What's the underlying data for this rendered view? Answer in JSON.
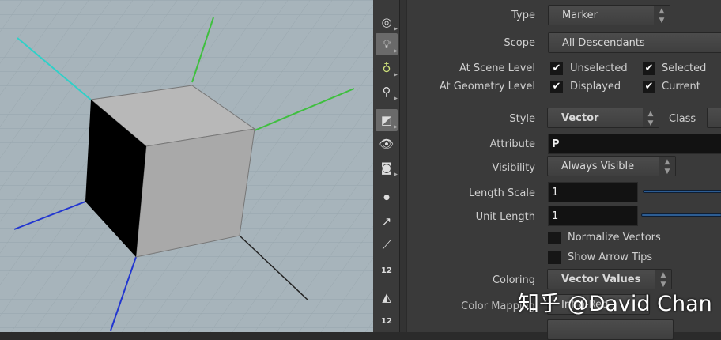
{
  "panel": {
    "type": {
      "label": "Type",
      "value": "Marker"
    },
    "scope": {
      "label": "Scope",
      "value": "All Descendants"
    },
    "scene_level": {
      "label": "At Scene Level",
      "unselected": "Unselected",
      "selected": "Selected",
      "unselected_checked": true,
      "selected_checked": true
    },
    "geometry_level": {
      "label": "At Geometry Level",
      "displayed": "Displayed",
      "current": "Current",
      "displayed_checked": true,
      "current_checked": true
    },
    "style": {
      "label": "Style",
      "value": "Vector"
    },
    "class": {
      "label": "Class"
    },
    "attribute": {
      "label": "Attribute",
      "value": "P"
    },
    "visibility": {
      "label": "Visibility",
      "value": "Always Visible"
    },
    "length_scale": {
      "label": "Length Scale",
      "value": "1"
    },
    "unit_length": {
      "label": "Unit Length",
      "value": "1"
    },
    "normalize": {
      "label": "Normalize Vectors",
      "checked": false
    },
    "arrow_tips": {
      "label": "Show Arrow Tips",
      "checked": false
    },
    "coloring": {
      "label": "Coloring",
      "value": "Vector Values"
    },
    "color_mapping": {
      "label": "Color Mapping",
      "value": "Infra-Red"
    },
    "check_glyph": "✔"
  },
  "toolbar": {
    "badge_12": "12"
  },
  "watermark": "知乎 @David Chan"
}
